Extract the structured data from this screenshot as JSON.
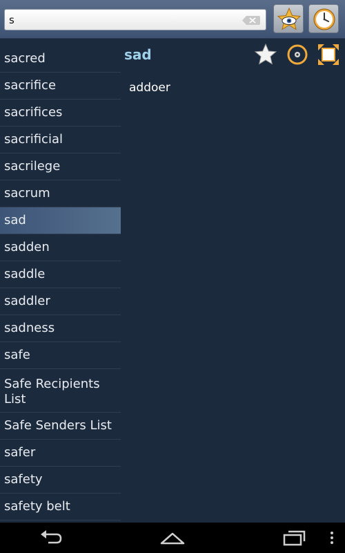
{
  "search": {
    "value": "s",
    "placeholder": ""
  },
  "word_list": [
    "sacred",
    "sacrifice",
    "sacrifices",
    "sacrificial",
    "sacrilege",
    "sacrum",
    "sad",
    "sadden",
    "saddle",
    "saddler",
    "sadness",
    "safe",
    "Safe Recipients List",
    "Safe Senders List",
    "safer",
    "safety",
    "safety belt"
  ],
  "selected_index": 6,
  "entry": {
    "headword": "sad",
    "translation": "addoer"
  },
  "colors": {
    "accent": "#9fd0ea",
    "background": "#1c2a3e",
    "selected": "#56708f"
  }
}
